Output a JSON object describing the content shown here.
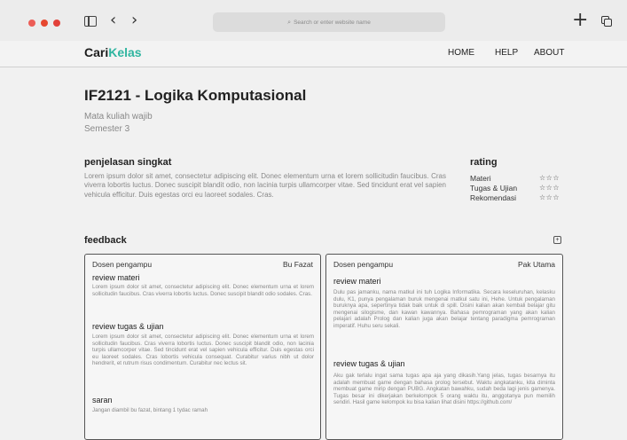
{
  "browser": {
    "address_placeholder": "Search or enter website name",
    "search_icon": "magnifier-icon",
    "nav_back": "‹",
    "nav_forward": "›",
    "new_tab": "+"
  },
  "site": {
    "logo_part1": "Cari",
    "logo_part2": "Kelas",
    "logo_color": "#2fb5a0",
    "nav": [
      "HOME",
      "HELP",
      "ABOUT"
    ]
  },
  "course": {
    "title": "IF2121 - Logika Komputasional",
    "type": "Mata kuliah wajib",
    "semester": "Semester 3"
  },
  "summary": {
    "heading": "penjelasan singkat",
    "text": "Lorem ipsum dolor sit amet, consectetur adipiscing elit. Donec elementum urna et lorem sollicitudin faucibus. Cras viverra lobortis luctus. Donec suscipit blandit odio, non lacinia turpis ullamcorper vitae. Sed tincidunt erat vel sapien vehicula efficitur. Duis egestas orci eu laoreet sodales. Cras."
  },
  "rating": {
    "heading": "rating",
    "items": [
      {
        "label": "Materi",
        "stars": "☆☆☆"
      },
      {
        "label": "Tugas & Ujian",
        "stars": "☆☆☆"
      },
      {
        "label": "Rekomendasi",
        "stars": "☆☆☆"
      }
    ]
  },
  "feedback": {
    "heading": "feedback",
    "toggle_symbol": "+",
    "cards": [
      {
        "dosen_label": "Dosen pengampu",
        "dosen_name": "Bu Fazat",
        "review_materi_heading": "review materi",
        "review_materi_text": "Lorem ipsum dolor sit amet, consectetur adipiscing elit. Donec elementum urna et lorem sollicitudin faucibus. Cras viverra lobortis luctus. Donec suscipit blandit odio sodales. Cras.",
        "review_tugas_heading": "review tugas & ujian",
        "review_tugas_text": "Lorem ipsum dolor sit amet, consectetur adipiscing elit. Donec elementum urna et lorem sollicitudin faucibus. Cras viverra lobortis luctus. Donec suscipit blandit odio, non lacinia turpis ullamcorper vitae. Sed tincidunt erat vel sapien vehicula efficitur. Duis egestas orci eu laoreet sodales. Cras lobortis vehicula consequat. Curabitur varius nibh ut dolor hendrerit, et rutrum risus condimentum. Curabitur nec lectus sit.",
        "saran_heading": "saran",
        "saran_text": "Jangan diambil bu fazat, bintang 1 tydac ramah"
      },
      {
        "dosen_label": "Dosen pengampu",
        "dosen_name": "Pak Utama",
        "review_materi_heading": "review materi",
        "review_materi_text": "Dulu pas jamanku, nama matkul ini tuh Logika Informatika. Secara keseluruhan, kelasku dulu, K1, punya pengalaman buruk mengenai matkul satu ini, Hehe. Untuk pengalaman buruknya apa, sepertinya tidak baik untuk di spill. Disini kalian akan kembali belajar gitu mengenai silogisme, dan kawan kawannya. Bahasa pemrograman yang akan kalian pelajari adalah Prolog dan kalian juga akan belajar tentang paradigma pemrograman imperatif. Huhu seru sekali.",
        "review_tugas_heading": "review tugas & ujian",
        "review_tugas_text": "Aku gak terlalu ingat sama tugas apa aja yang dikasih.Yang jelas, tugas besarnya itu adalah membuat game dengan bahasa prolog tersebut. Waktu angkatanku, kita diminta membuat game mirip dengan PUBG. Angkatan bawahku, sudah beda lagi jenis gamenya. Tugas besar ini dikerjakan berkelompok 5 orang waktu itu, anggotanya pun memilih sendiri. Hasil game kelompok ku bisa kalian lihat disini https://github.com/"
      }
    ]
  }
}
